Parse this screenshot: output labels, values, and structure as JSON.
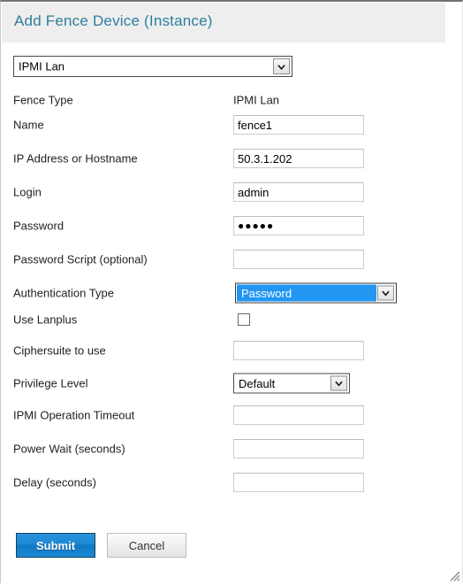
{
  "header": {
    "title": "Add Fence Device (Instance)"
  },
  "device_type_select": {
    "name": "fence-type-selector",
    "value": "IPMI Lan",
    "icon": "chevron-down-icon"
  },
  "form": {
    "rows": [
      {
        "label": "Fence Type",
        "kind": "static",
        "value": "IPMI Lan"
      },
      {
        "label": "Name",
        "kind": "text",
        "value": "fence1",
        "placeholder": ""
      },
      {
        "label": "IP Address or Hostname",
        "kind": "text",
        "value": "50.3.1.202",
        "placeholder": ""
      },
      {
        "label": "Login",
        "kind": "text",
        "value": "admin",
        "placeholder": ""
      },
      {
        "label": "Password",
        "kind": "password",
        "value": "●●●●●",
        "placeholder": ""
      },
      {
        "label": "Password Script (optional)",
        "kind": "text",
        "value": "",
        "placeholder": ""
      },
      {
        "label": "Authentication Type",
        "kind": "select-focused",
        "value": "Password"
      },
      {
        "label": "Use Lanplus",
        "kind": "checkbox",
        "checked": false
      },
      {
        "label": "Ciphersuite to use",
        "kind": "text",
        "value": "",
        "placeholder": ""
      },
      {
        "label": "Privilege Level",
        "kind": "select",
        "value": "Default"
      },
      {
        "label": "IPMI Operation Timeout",
        "kind": "text",
        "value": "",
        "placeholder": ""
      },
      {
        "label": "Power Wait (seconds)",
        "kind": "text",
        "value": "",
        "placeholder": ""
      },
      {
        "label": "Delay (seconds)",
        "kind": "text",
        "value": "",
        "placeholder": ""
      }
    ]
  },
  "buttons": {
    "submit_label": "Submit",
    "cancel_label": "Cancel"
  },
  "colors": {
    "title": "#2b7f9e",
    "header_band": "#efeeee",
    "submit_blue": "#1e87d4",
    "select_highlight": "#2196f3"
  },
  "resize_grip": {
    "icon": "resize-grip-icon"
  }
}
